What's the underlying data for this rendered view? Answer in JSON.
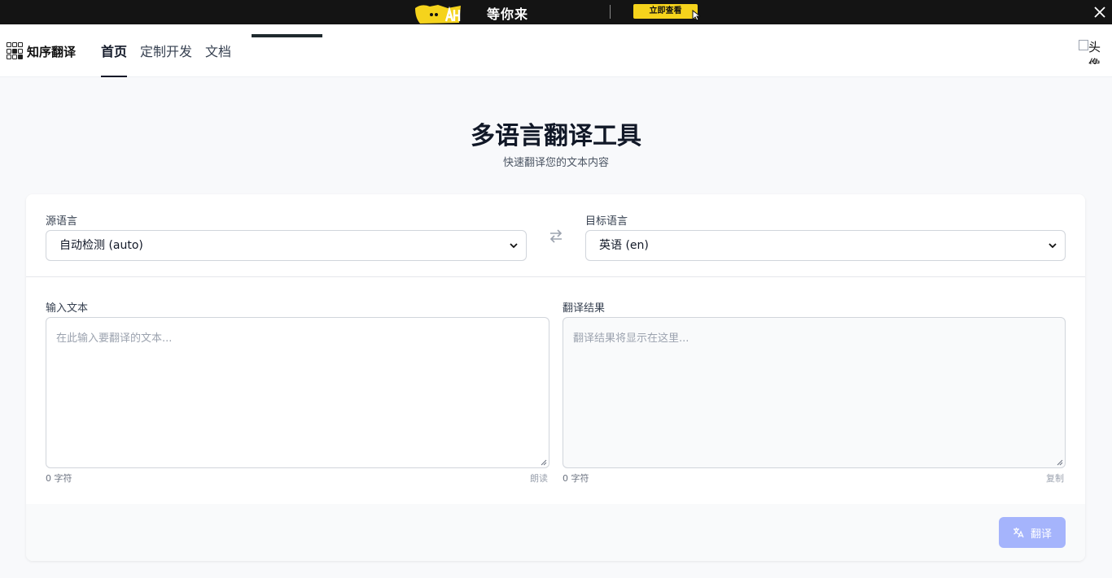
{
  "banner": {
    "mascot_text": "ᴀᴀA",
    "promo_text": "等你来",
    "cta_label": "立即查看",
    "close_icon": "close-icon"
  },
  "nav": {
    "logo_text": "知序翻译",
    "items": [
      {
        "label": "首页",
        "active": true
      },
      {
        "label": "定制开发",
        "active": false
      },
      {
        "label": "文档",
        "active": false
      }
    ],
    "avatar_alt": "头像"
  },
  "header": {
    "title": "多语言翻译工具",
    "subtitle": "快速翻译您的文本内容"
  },
  "languages": {
    "source_label": "源语言",
    "source_value": "自动检测 (auto)",
    "target_label": "目标语言",
    "target_value": "英语 (en)",
    "swap_icon": "swap-icon"
  },
  "input": {
    "label": "输入文本",
    "placeholder": "在此输入要翻译的文本...",
    "char_count": "0 字符",
    "read_aloud": "朗读"
  },
  "output": {
    "label": "翻译结果",
    "placeholder": "翻译结果将显示在这里...",
    "char_count": "0 字符",
    "copy": "复制"
  },
  "actions": {
    "translate_label": "翻译"
  },
  "colors": {
    "banner_bg": "#141414",
    "cta_yellow": "#f5d31c",
    "button_disabled": "#a5b4fc",
    "page_bg": "#f8f9fb"
  }
}
